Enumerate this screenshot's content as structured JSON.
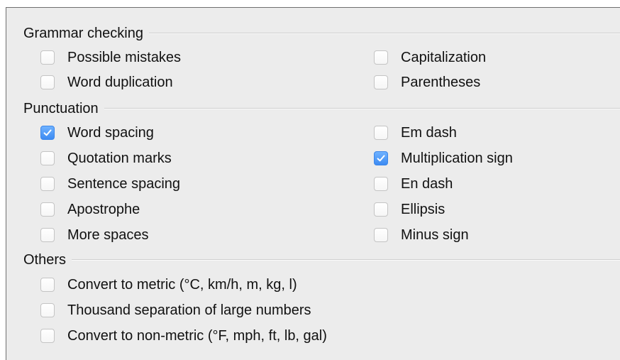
{
  "sections": {
    "grammar": {
      "title": "Grammar checking",
      "options": [
        {
          "label": "Possible mistakes",
          "checked": false
        },
        {
          "label": "Capitalization",
          "checked": false
        },
        {
          "label": "Word duplication",
          "checked": false
        },
        {
          "label": "Parentheses",
          "checked": false
        }
      ]
    },
    "punctuation": {
      "title": "Punctuation",
      "options": [
        {
          "label": "Word spacing",
          "checked": true
        },
        {
          "label": "Em dash",
          "checked": false
        },
        {
          "label": "Quotation marks",
          "checked": false
        },
        {
          "label": "Multiplication sign",
          "checked": true
        },
        {
          "label": "Sentence spacing",
          "checked": false
        },
        {
          "label": "En dash",
          "checked": false
        },
        {
          "label": "Apostrophe",
          "checked": false
        },
        {
          "label": "Ellipsis",
          "checked": false
        },
        {
          "label": "More spaces",
          "checked": false
        },
        {
          "label": "Minus sign",
          "checked": false
        }
      ]
    },
    "others": {
      "title": "Others",
      "options": [
        {
          "label": "Convert to metric (°C, km/h, m, kg, l)",
          "checked": false
        },
        {
          "label": "Thousand separation of large numbers",
          "checked": false
        },
        {
          "label": "Convert to non-metric (°F, mph, ft, lb, gal)",
          "checked": false
        }
      ]
    }
  },
  "colors": {
    "checked_fill": "#4a97f7",
    "panel_bg": "#ececec"
  }
}
